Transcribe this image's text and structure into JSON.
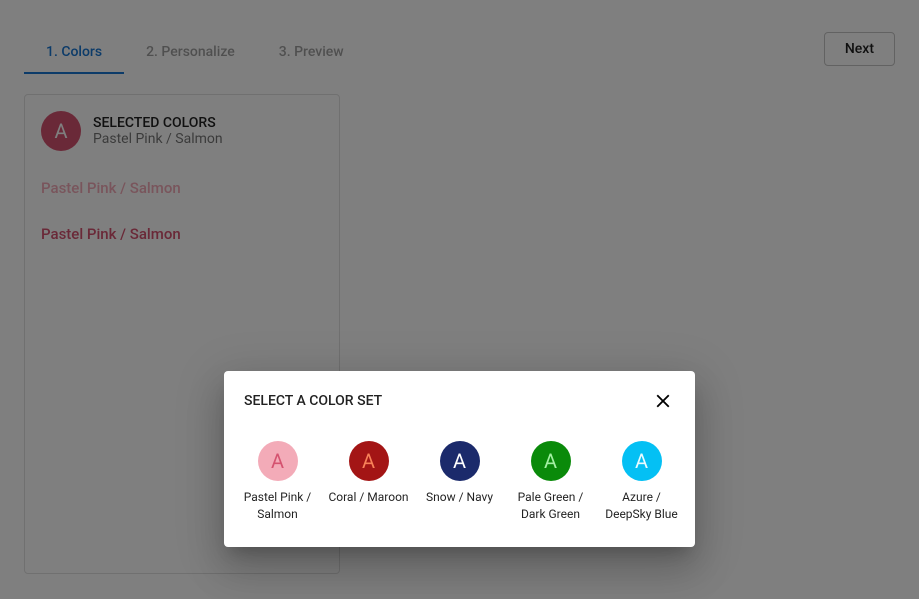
{
  "header": {
    "tabs": [
      {
        "label": "1. Colors",
        "active": true
      },
      {
        "label": "2. Personalize",
        "active": false
      },
      {
        "label": "3. Preview",
        "active": false
      }
    ],
    "next_label": "Next"
  },
  "card": {
    "title": "SELECTED COLORS",
    "subtitle": "Pastel Pink / Salmon",
    "avatar_letter": "A",
    "avatar_bg": "#d55370",
    "lines": [
      {
        "text": "Pastel Pink / Salmon",
        "color": "#f3abb8"
      },
      {
        "text": "Pastel Pink / Salmon",
        "color": "#d55370"
      }
    ]
  },
  "dialog": {
    "title": "SELECT A COLOR SET",
    "swatches": [
      {
        "label": "Pastel Pink / Salmon",
        "bg": "#f3abb8",
        "fg": "#d55370",
        "letter": "A"
      },
      {
        "label": "Coral / Maroon",
        "bg": "#a31515",
        "fg": "#f88158",
        "letter": "A"
      },
      {
        "label": "Snow / Navy",
        "bg": "#1b2a6b",
        "fg": "#fefefe",
        "letter": "A"
      },
      {
        "label": "Pale Green / Dark Green",
        "bg": "#0a8a0a",
        "fg": "#a3f0a3",
        "letter": "A"
      },
      {
        "label": "Azure / DeepSky Blue",
        "bg": "#04c0f4",
        "fg": "#e9fbff",
        "letter": "A"
      }
    ]
  }
}
